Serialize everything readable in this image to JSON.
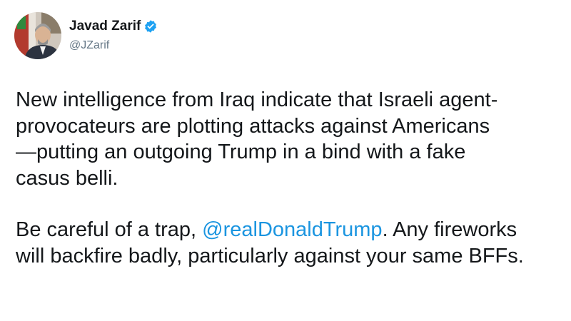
{
  "author": {
    "display_name": "Javad Zarif",
    "handle": "@JZarif",
    "verified": true,
    "avatar_icon": "avatar-portrait",
    "verified_icon": "verified-badge-icon"
  },
  "tweet": {
    "paragraph1": {
      "line1": "New intelligence from Iraq indicate that Israeli agent-",
      "line2": "provocateurs are plotting attacks against Americans",
      "line3": "—putting an outgoing Trump in a bind with a fake",
      "line4": "casus belli."
    },
    "paragraph2": {
      "line1_before": "Be careful of a trap, ",
      "mention": "@realDonaldTrump",
      "line1_after": ". Any fireworks",
      "line2": "will backfire badly, particularly against your same BFFs."
    }
  },
  "colors": {
    "text": "#14171a",
    "handle": "#657786",
    "mention": "#1b95e0",
    "verified": "#1da1f2"
  }
}
